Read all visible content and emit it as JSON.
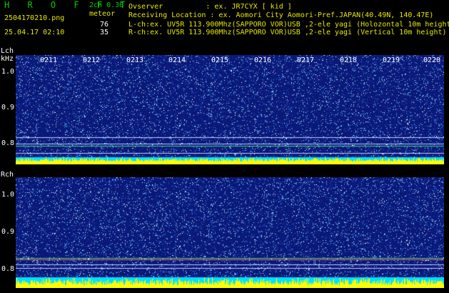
{
  "header": {
    "app_title": "H R O F F T",
    "mode": "2ch 0.30",
    "filename": "2504170210.png",
    "datetime": "25.04.17 02:10",
    "meteor_label": "meteor",
    "l_count": "76",
    "r_count": "35",
    "observer": "Ovserver          : ex. JR7CYX [ kid ]",
    "location": "Receiving Location : ex. Aomori City Aomori-Pref.JAPAN(40.49N, 140.47E)",
    "l_channel": "L-ch:ex. UV5R 113.900Mhz(SAPPORO VOR)USB ,2-ele yagi (Holozontal 10m height)",
    "r_channel": "R-ch:ex. UV5R 113.900Mhz(SAPPORO VOR)USB ,2-ele yagi (Vertical 10m height)"
  },
  "axis": {
    "lch_label": "Lch",
    "khz_label": "kHz",
    "rch_label": "Rch",
    "time_ticks": [
      "0211",
      "0212",
      "0213",
      "0214",
      "0215",
      "0216",
      "0217",
      "0218",
      "0219",
      "0220"
    ],
    "freq_ticks_l": [
      "1.0",
      "0.9",
      "0.8"
    ],
    "freq_ticks_r": [
      "1.0",
      "0.9",
      "0.8"
    ]
  },
  "colors": {
    "background": "#000000",
    "spectrum_bg": "#0a1878",
    "signal": "#ffff00",
    "noise_floor": "#00e0ff",
    "header_green": "#00d000",
    "header_yellow": "#e8e800",
    "reference_line": "#c8c8ff"
  }
}
